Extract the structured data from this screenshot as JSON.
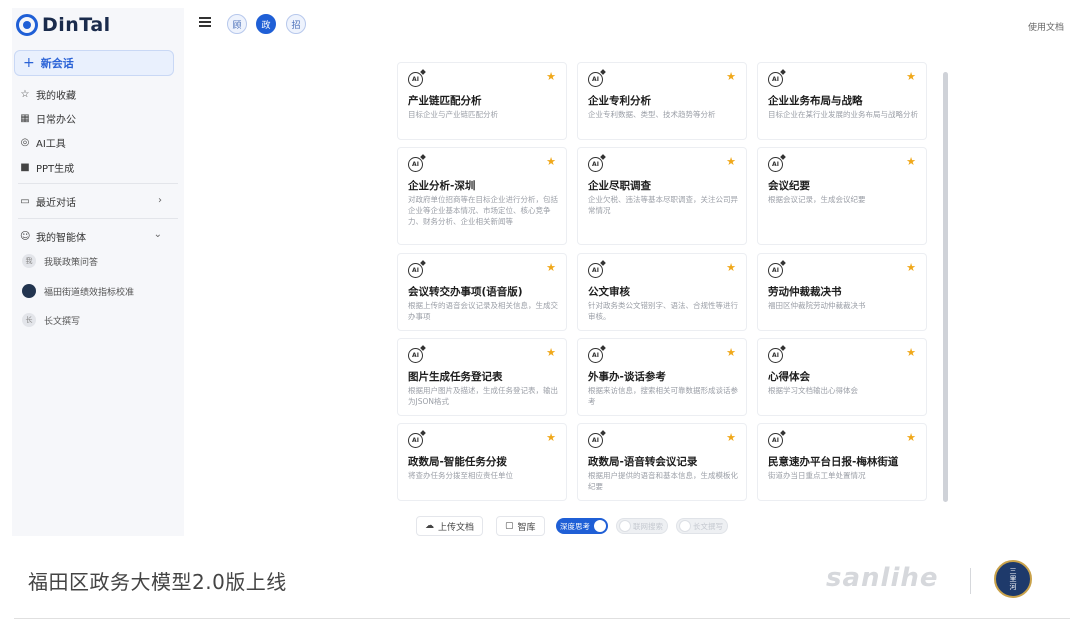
{
  "app": {
    "brand": "DinTal",
    "docs_link": "使用文档"
  },
  "sidebar": {
    "new_chat": "新会话",
    "items": [
      {
        "label": "我的收藏",
        "icon": "star-outline-icon"
      },
      {
        "label": "日常办公",
        "icon": "apps-icon"
      },
      {
        "label": "AI工具",
        "icon": "ai-tool-icon"
      },
      {
        "label": "PPT生成",
        "icon": "ppt-icon"
      }
    ],
    "recent": {
      "label": "最近对话",
      "icon": "chat-icon"
    },
    "agents": {
      "label": "我的智能体",
      "items": [
        {
          "label": "我联政策问答",
          "avatar": "我"
        },
        {
          "label": "福田街道绩效指标校准",
          "avatar": ""
        },
        {
          "label": "长文撰写",
          "avatar": "长"
        }
      ]
    }
  },
  "topbar": {
    "modes": [
      "顾",
      "政",
      "招"
    ],
    "active_mode": 1
  },
  "cards": [
    {
      "title": "产业链匹配分析",
      "desc": "目标企业与产业链匹配分析"
    },
    {
      "title": "企业专利分析",
      "desc": "企业专利数据、类型、技术趋势等分析"
    },
    {
      "title": "企业业务布局与战略",
      "desc": "目标企业在某行业发展的业务布局与战略分析"
    },
    {
      "title": "企业分析-深圳",
      "desc": "对政府单位招商等在目标企业进行分析，包括企业等企业基本情况、市场定位、核心竞争力、财务分析、企业相关新闻等"
    },
    {
      "title": "企业尽职调查",
      "desc": "企业欠税、违法等基本尽职调查，关注公司异常情况"
    },
    {
      "title": "会议纪要",
      "desc": "根据会议记录，生成会议纪要"
    },
    {
      "title": "会议转交办事项(语音版)",
      "desc": "根据上传的语音会议记录及相关信息，生成交办事项"
    },
    {
      "title": "公文审核",
      "desc": "针对政务类公文错别字、语法、合规性等进行审核。"
    },
    {
      "title": "劳动仲裁裁决书",
      "desc": "福田区仲裁院劳动仲裁裁决书"
    },
    {
      "title": "图片生成任务登记表",
      "desc": "根据用户图片及描述，生成任务登记表，输出为JSON格式"
    },
    {
      "title": "外事办-谈话参考",
      "desc": "根据来访信息，搜索相关可靠数据形成谈话参考"
    },
    {
      "title": "心得体会",
      "desc": "根据学习文档输出心得体会"
    },
    {
      "title": "政数局-智能任务分拨",
      "desc": "将查办任务分拨至相应责任单位"
    },
    {
      "title": "政数局-语音转会议记录",
      "desc": "根据用户提供的语音和基本信息，生成模板化纪要"
    },
    {
      "title": "民意速办平台日报-梅林街道",
      "desc": "街道办当日重点工单处置情况"
    }
  ],
  "bottom": {
    "upload": "上传文档",
    "library": "智库",
    "toggles": [
      "深度思考",
      "联网搜索",
      "长文撰写"
    ]
  },
  "caption": {
    "text": "福田区政务大模型2.0版上线",
    "watermark": "sanlihe",
    "seal": [
      "三",
      "里",
      "河"
    ]
  },
  "colors": {
    "accent": "#1f5fd6",
    "star": "#f0a81a",
    "seal_bg": "#1e3a6b"
  }
}
